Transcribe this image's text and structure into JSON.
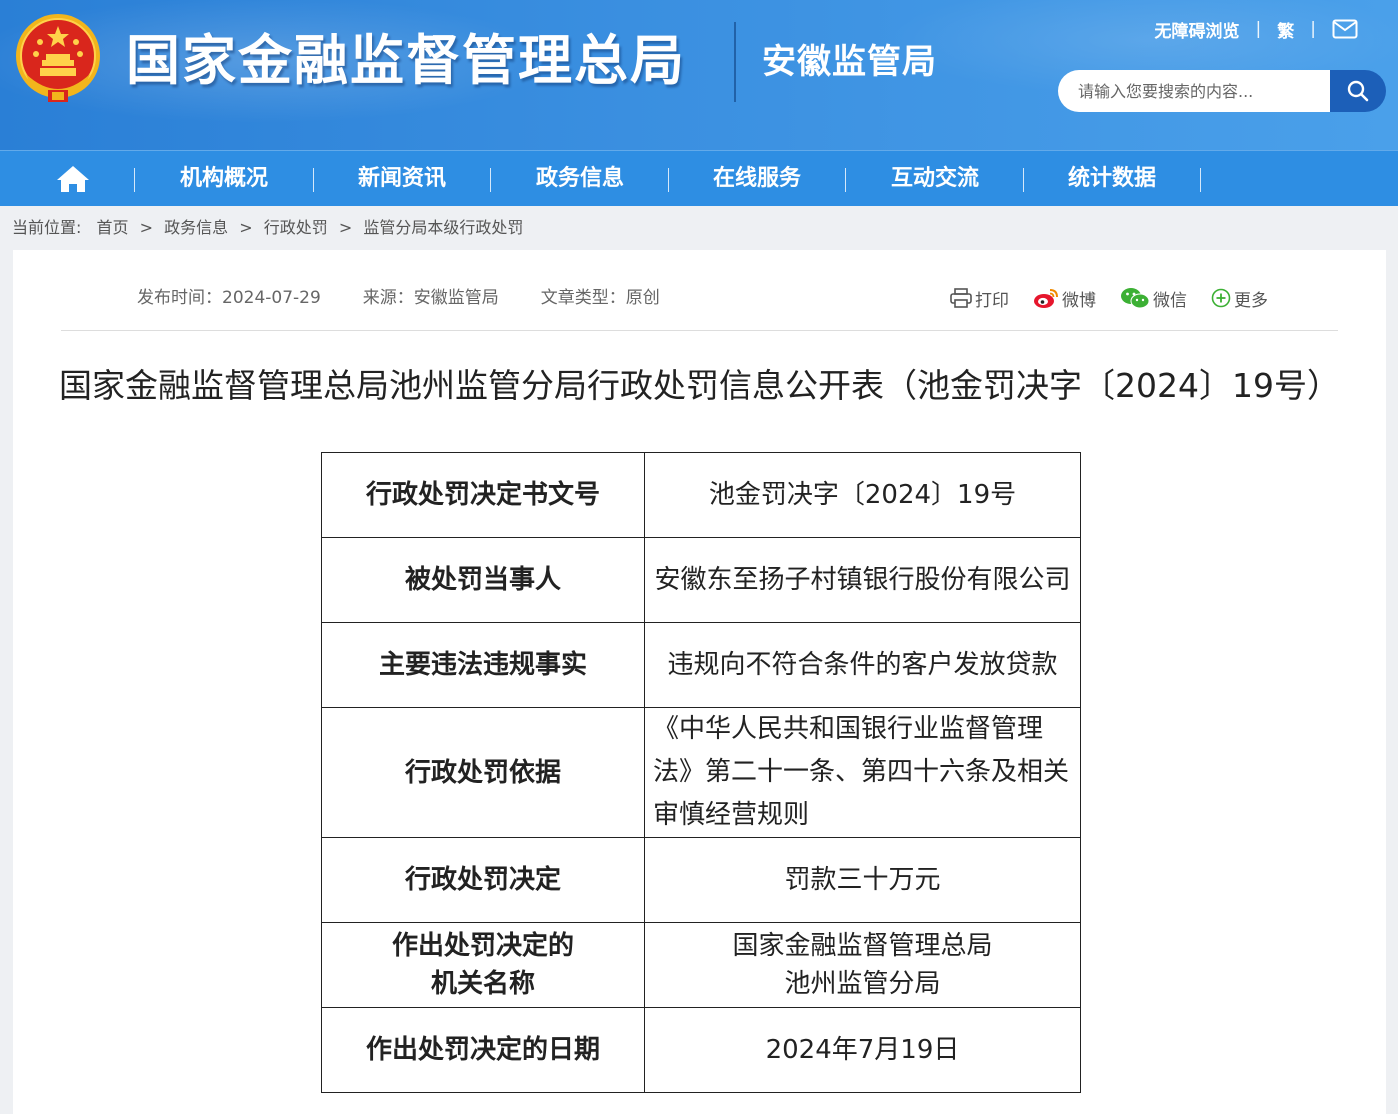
{
  "header": {
    "site_title": "国家金融监督管理总局",
    "sub_title": "安徽监管局",
    "top_links": [
      "无障碍浏览",
      "繁"
    ],
    "search_placeholder": "请输入您要搜索的内容..."
  },
  "nav": {
    "items": [
      "机构概况",
      "新闻资讯",
      "政务信息",
      "在线服务",
      "互动交流",
      "统计数据"
    ]
  },
  "breadcrumb": {
    "label": "当前位置:",
    "items": [
      "首页",
      "政务信息",
      "行政处罚",
      "监管分局本级行政处罚"
    ]
  },
  "meta": {
    "publish": "发布时间：2024-07-29",
    "source": "来源：安徽监管局",
    "type": "文章类型：原创"
  },
  "share": {
    "print": "打印",
    "weibo": "微博",
    "wechat": "微信",
    "more": "更多"
  },
  "article": {
    "title": "国家金融监督管理总局池州监管分局行政处罚信息公开表（池金罚决字〔2024〕19号）"
  },
  "table": {
    "rows": [
      {
        "key": "行政处罚决定书文号",
        "value": "池金罚决字〔2024〕19号"
      },
      {
        "key": "被处罚当事人",
        "value": "安徽东至扬子村镇银行股份有限公司"
      },
      {
        "key": "主要违法违规事实",
        "value": "违规向不符合条件的客户发放贷款"
      },
      {
        "key": "行政处罚依据",
        "value": "《中华人民共和国银行业监督管理法》第二十一条、第四十六条及相关审慎经营规则"
      },
      {
        "key": "行政处罚决定",
        "value": "罚款三十万元"
      },
      {
        "key_line1": "作出处罚决定的",
        "key_line2": "机关名称",
        "value_line1": "国家金融监督管理总局",
        "value_line2": "池州监管分局"
      },
      {
        "key": "作出处罚决定的日期",
        "value": "2024年7月19日"
      }
    ]
  }
}
